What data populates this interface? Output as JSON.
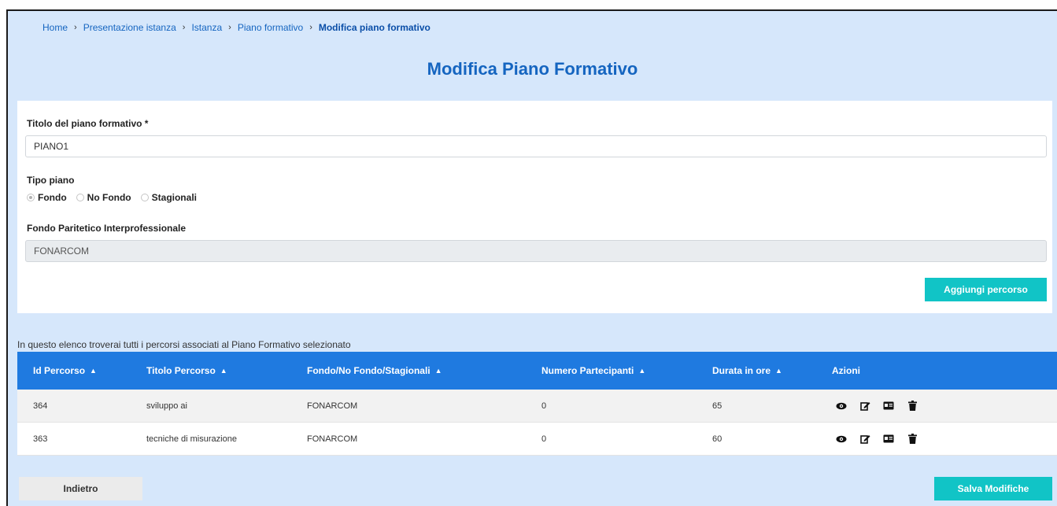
{
  "breadcrumb": {
    "items": [
      "Home",
      "Presentazione istanza",
      "Istanza",
      "Piano formativo"
    ],
    "current": "Modifica piano formativo",
    "separator": "›"
  },
  "page": {
    "title": "Modifica Piano Formativo"
  },
  "form": {
    "titolo_label": "Titolo del piano formativo *",
    "titolo_value": "PIANO1",
    "tipo_label": "Tipo piano",
    "tipo_options": [
      "Fondo",
      "No Fondo",
      "Stagionali"
    ],
    "tipo_selected": "Fondo",
    "fondo_label": "Fondo Paritetico Interprofessionale",
    "fondo_value": "FONARCOM",
    "add_button": "Aggiungi percorso"
  },
  "list": {
    "description": "In questo elenco troverai tutti i percorsi associati al Piano Formativo selezionato",
    "columns": [
      "Id Percorso",
      "Titolo Percorso",
      "Fondo/No Fondo/Stagionali",
      "Numero Partecipanti",
      "Durata in ore",
      "Azioni"
    ],
    "rows": [
      {
        "id": "364",
        "titolo": "sviluppo ai",
        "fondo": "FONARCOM",
        "partecipanti": "0",
        "durata": "65"
      },
      {
        "id": "363",
        "titolo": "tecniche di misurazione",
        "fondo": "FONARCOM",
        "partecipanti": "0",
        "durata": "60"
      }
    ],
    "action_icons": [
      "eye-icon",
      "edit-icon",
      "id-card-icon",
      "trash-icon"
    ]
  },
  "footer": {
    "back_button": "Indietro",
    "save_button": "Salva Modifiche"
  },
  "colors": {
    "brand_blue": "#1565c0",
    "header_blue": "#1f7ae0",
    "accent_teal": "#11c4c6",
    "page_bg": "#d6e7fb"
  }
}
